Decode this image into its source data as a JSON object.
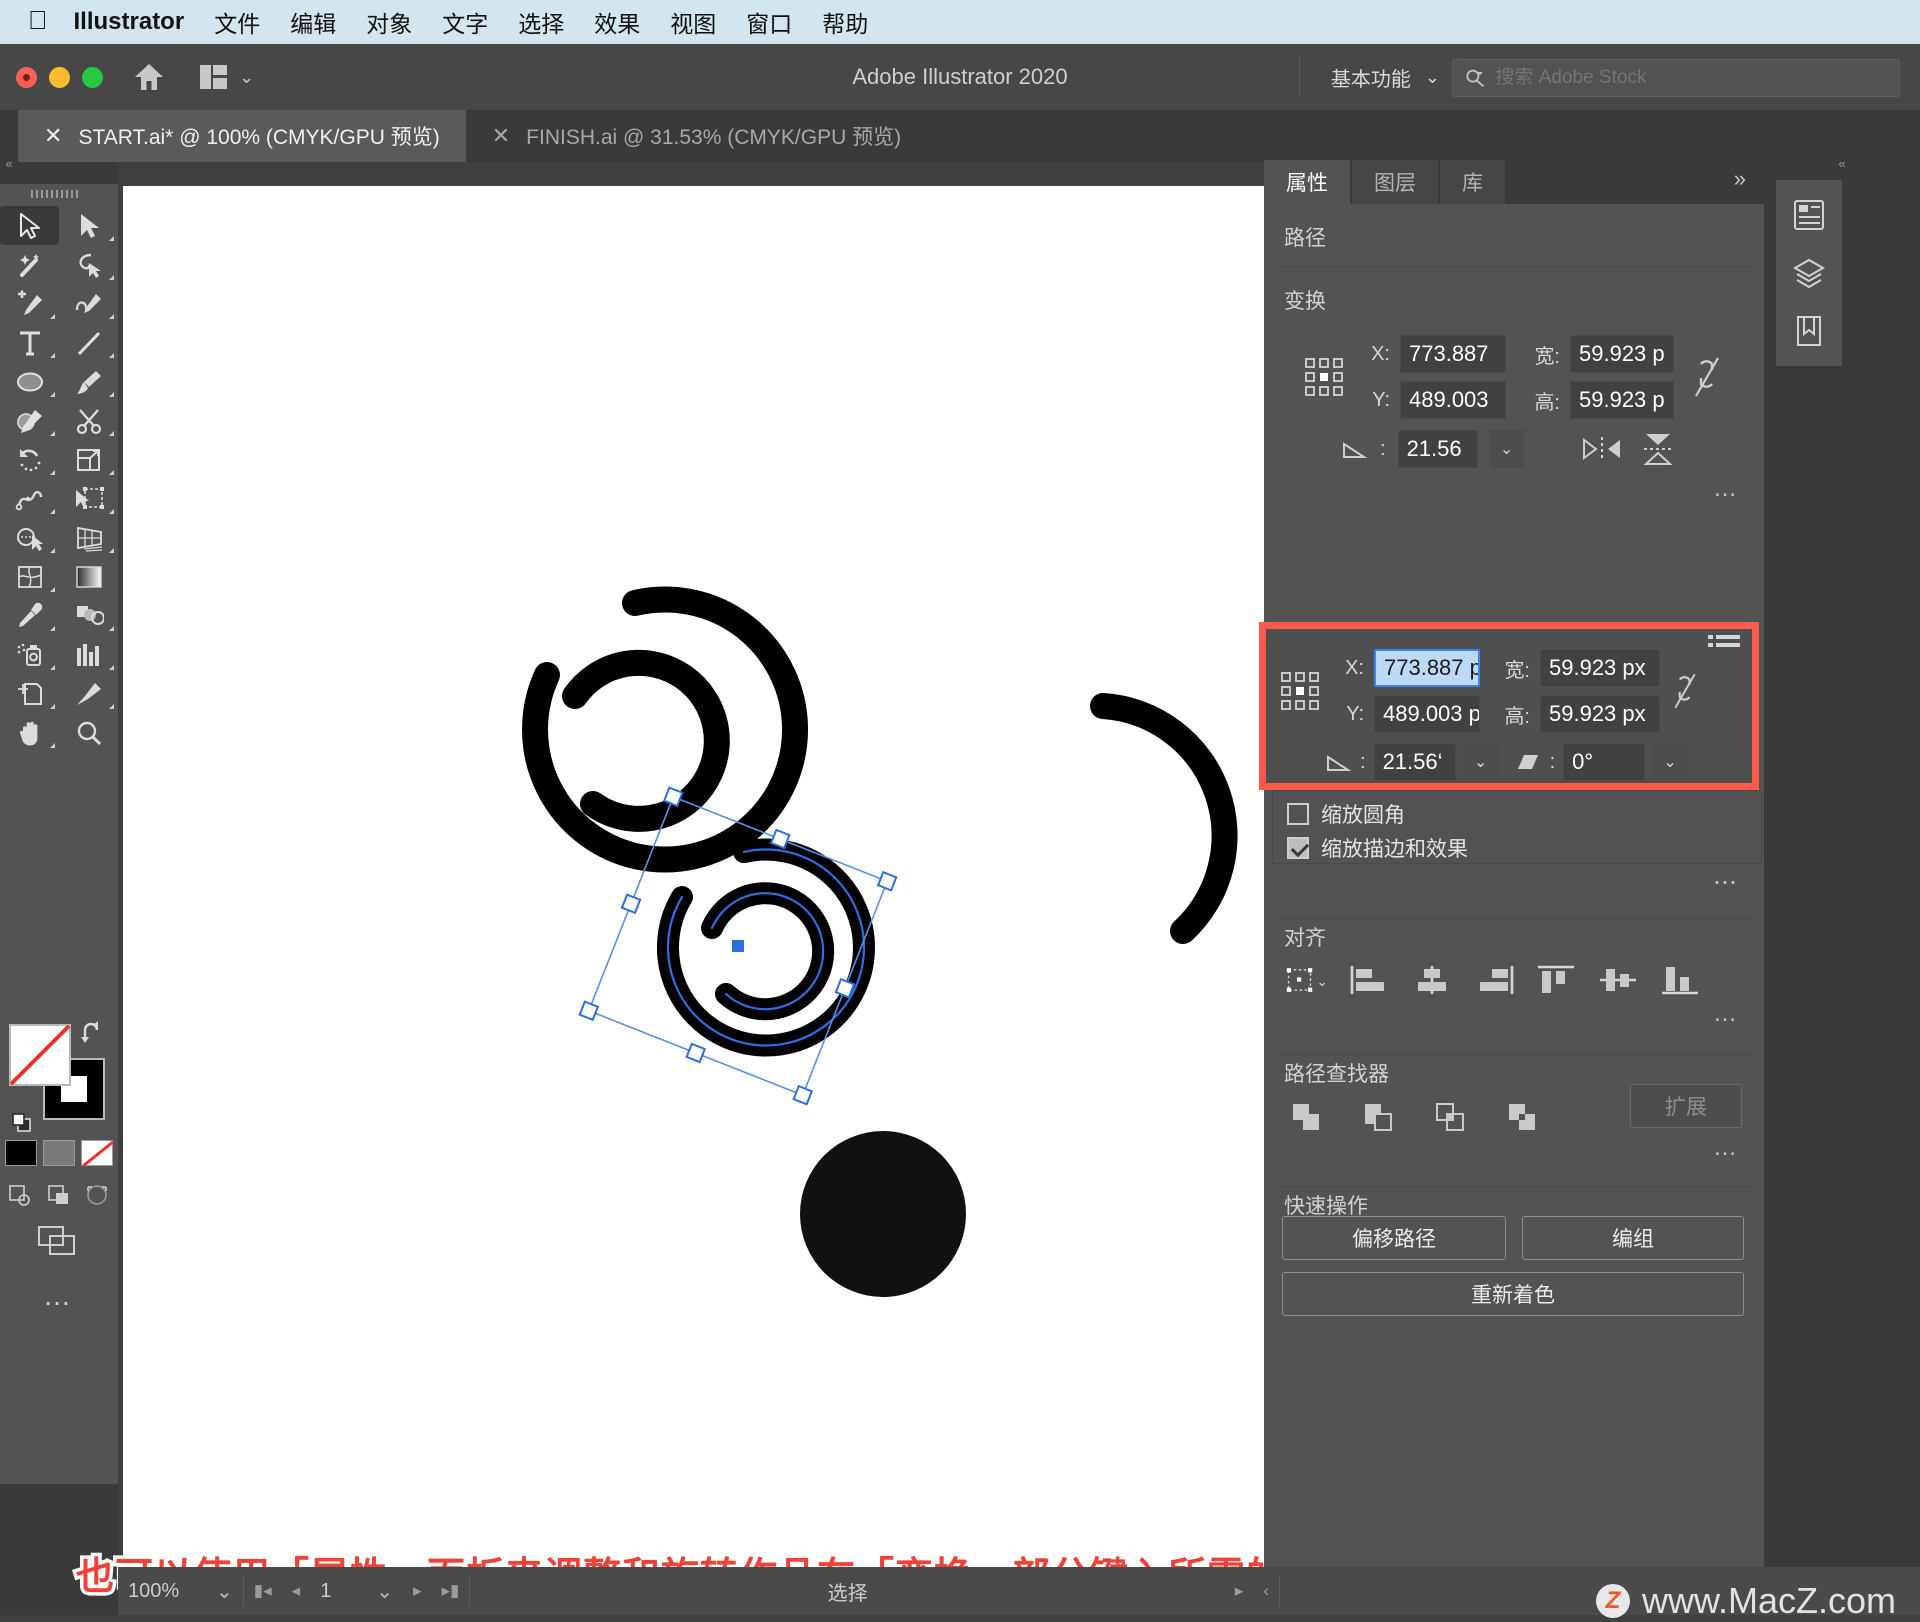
{
  "menubar": {
    "apple_icon": "apple-icon",
    "app_name": "Illustrator",
    "items": [
      "文件",
      "编辑",
      "对象",
      "文字",
      "选择",
      "效果",
      "视图",
      "窗口",
      "帮助"
    ]
  },
  "titlebar": {
    "title": "Adobe Illustrator 2020",
    "workspace": "基本功能",
    "home_icon": "home-icon",
    "arrange_icon": "arrange-documents-icon",
    "chevron_icon": "chevron-down-icon",
    "search": {
      "icon": "search-icon",
      "placeholder": "搜索 Adobe Stock",
      "value": ""
    }
  },
  "tabs": [
    {
      "label": "START.ai* @ 100% (CMYK/GPU 预览)",
      "active": true,
      "close_icon": "close-icon"
    },
    {
      "label": "FINISH.ai @ 31.53% (CMYK/GPU 预览)",
      "active": false,
      "close_icon": "close-icon"
    }
  ],
  "toolbar": {
    "tools": [
      "selection-tool",
      "direct-selection-tool",
      "magic-wand-tool",
      "lasso-tool",
      "add-anchor-point-tool",
      "curvature-tool",
      "type-tool",
      "line-segment-tool",
      "ellipse-tool",
      "paintbrush-tool",
      "shaper-tool",
      "scissors-tool",
      "rotate-tool",
      "scale-tool",
      "width-tool",
      "free-transform-tool",
      "shape-builder-tool",
      "perspective-grid-tool",
      "mesh-tool",
      "gradient-tool",
      "eyedropper-tool",
      "blend-tool",
      "symbol-sprayer-tool",
      "column-graph-tool",
      "artboard-tool",
      "slice-tool",
      "hand-tool",
      "zoom-tool"
    ],
    "selected_index": 0,
    "fill_color": "#ffffff",
    "fill_none": true,
    "stroke_color": "#000000",
    "swap_icon": "swap-fill-stroke-icon",
    "default_icon": "default-fill-stroke-icon",
    "color_swatches": [
      "#000000",
      "#808080",
      "#ffffff"
    ],
    "draw_modes": [
      "draw-normal-icon",
      "draw-behind-icon",
      "draw-inside-icon"
    ],
    "screen_mode_icon": "screen-mode-icon",
    "more_tools": "…"
  },
  "panel": {
    "tabs": [
      {
        "label": "属性",
        "active": true
      },
      {
        "label": "图层",
        "active": false
      },
      {
        "label": "库",
        "active": false
      }
    ],
    "collapse_icon": "expand-panels-icon",
    "object_type": "路径",
    "transform": {
      "title": "变换",
      "reference_point_icon": "reference-point-grid-icon",
      "x_label": "X:",
      "x_value": "773.887",
      "y_label": "Y:",
      "y_value": "489.003",
      "w_label": "宽:",
      "w_value": "59.923 p",
      "h_label": "高:",
      "h_value": "59.923 p",
      "link_icon": "link-broken-icon",
      "angle_icon": "rotate-angle-icon",
      "angle_value": "21.56",
      "flip_h_icon": "flip-horizontal-icon",
      "flip_v_icon": "flip-vertical-icon",
      "more_options": "…"
    },
    "popup": {
      "menu_icon": "panel-menu-icon",
      "reference_point_icon": "reference-point-grid-icon",
      "x_label": "X:",
      "x_value": "773.887 p",
      "y_label": "Y:",
      "y_value": "489.003 p",
      "w_label": "宽:",
      "w_value": "59.923 px",
      "h_label": "高:",
      "h_value": "59.923 px",
      "link_icon": "link-broken-icon",
      "angle_icon": "rotate-angle-icon",
      "angle_value": "21.56‘",
      "shear_icon": "shear-icon",
      "shear_value": "0°",
      "highlight_color": "#fb5a4b"
    },
    "checkboxes": [
      {
        "label": "缩放圆角",
        "checked": false
      },
      {
        "label": "缩放描边和效果",
        "checked": true
      }
    ],
    "align": {
      "title": "对齐",
      "align_to_icon": "align-to-selection-icon",
      "buttons": [
        "align-left-icon",
        "align-horizontal-center-icon",
        "align-right-icon",
        "align-top-icon",
        "align-vertical-center-icon",
        "align-bottom-icon"
      ],
      "more_options": "…"
    },
    "pathfinder": {
      "title": "路径查找器",
      "buttons": [
        "unite-icon",
        "minus-front-icon",
        "intersect-icon",
        "exclude-icon"
      ],
      "expand_label": "扩展",
      "expand_disabled": true,
      "more_options": "…"
    },
    "quick_actions": {
      "title": "快速操作",
      "buttons": [
        "偏移路径",
        "编组",
        "重新着色"
      ]
    }
  },
  "iconstrip": {
    "icons": [
      "properties-panel-icon",
      "layers-panel-icon",
      "libraries-panel-icon"
    ]
  },
  "statusbar": {
    "zoom": "100%",
    "zoom_chevron": "chevron-down-icon",
    "first_page_icon": "first-page-icon",
    "prev_page_icon": "prev-page-icon",
    "page": "1",
    "page_chevron": "chevron-down-icon",
    "next_page_icon": "next-page-icon",
    "last_page_icon": "last-page-icon",
    "status_text": "选择",
    "play_icon": "play-icon",
    "back_icon": "back-icon"
  },
  "caption": {
    "text": "也可以使用「属性」面板来调整和旋转作品在「变换」部分键入所需的值",
    "color": "#ef4136"
  },
  "watermark": {
    "badge": "Z",
    "text": "www.MacZ.com"
  },
  "canvas": {
    "shapes": [
      {
        "name": "double-arc-circle-large",
        "selected": false
      },
      {
        "name": "double-arc-circle-small",
        "selected": true
      },
      {
        "name": "partial-arc-right",
        "selected": false
      },
      {
        "name": "filled-circle",
        "selected": false
      }
    ],
    "selection_color": "#2b6fe0"
  }
}
